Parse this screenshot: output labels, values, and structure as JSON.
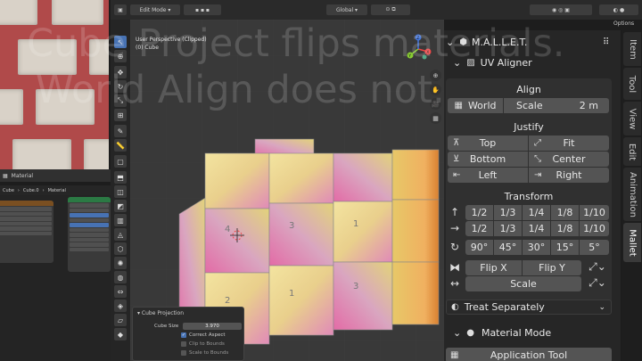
{
  "overlay": {
    "line1": "Cube Project flips materials.",
    "line2": "World Align does not."
  },
  "header": {
    "mode": "Edit Mode",
    "orientation": "Global",
    "options": "Options"
  },
  "viewport": {
    "perspective": "User Perspective (Clipped)",
    "object": "(0) Cube",
    "gizmo": {
      "x": "X",
      "y": "Y",
      "z": "Z"
    }
  },
  "left": {
    "material_label": "Material",
    "breadcrumb": [
      "Cube",
      "Cube.0",
      "Material"
    ]
  },
  "cube_projection": {
    "title": "Cube Projection",
    "cube_size_label": "Cube Size",
    "cube_size_value": "3.970",
    "correct_aspect": "Correct Aspect",
    "clip_to_bounds": "Clip to Bounds",
    "scale_to_bounds": "Scale to Bounds"
  },
  "sidebar": {
    "addon_title": "M.A.L.L.E.T.",
    "panel_title": "UV Aligner",
    "align": {
      "title": "Align",
      "world": "World",
      "scale_label": "Scale",
      "scale_value": "2 m"
    },
    "justify": {
      "title": "Justify",
      "top": "Top",
      "fit": "Fit",
      "bottom": "Bottom",
      "center": "Center",
      "left": "Left",
      "right": "Right"
    },
    "transform": {
      "title": "Transform",
      "fractions": [
        "1/2",
        "1/3",
        "1/4",
        "1/8",
        "1/10"
      ],
      "angles": [
        "90°",
        "45°",
        "30°",
        "15°",
        "5°"
      ],
      "flip_x": "Flip X",
      "flip_y": "Flip Y",
      "scale": "Scale"
    },
    "treat_separately": "Treat Separately",
    "material_mode": "Material Mode",
    "application_tool": "Application Tool"
  },
  "tabs": [
    "Item",
    "Tool",
    "View",
    "Edit",
    "Animation",
    "Mallet"
  ],
  "colors": {
    "accent": "#4772b3",
    "button": "#545454",
    "panel": "#303030"
  }
}
